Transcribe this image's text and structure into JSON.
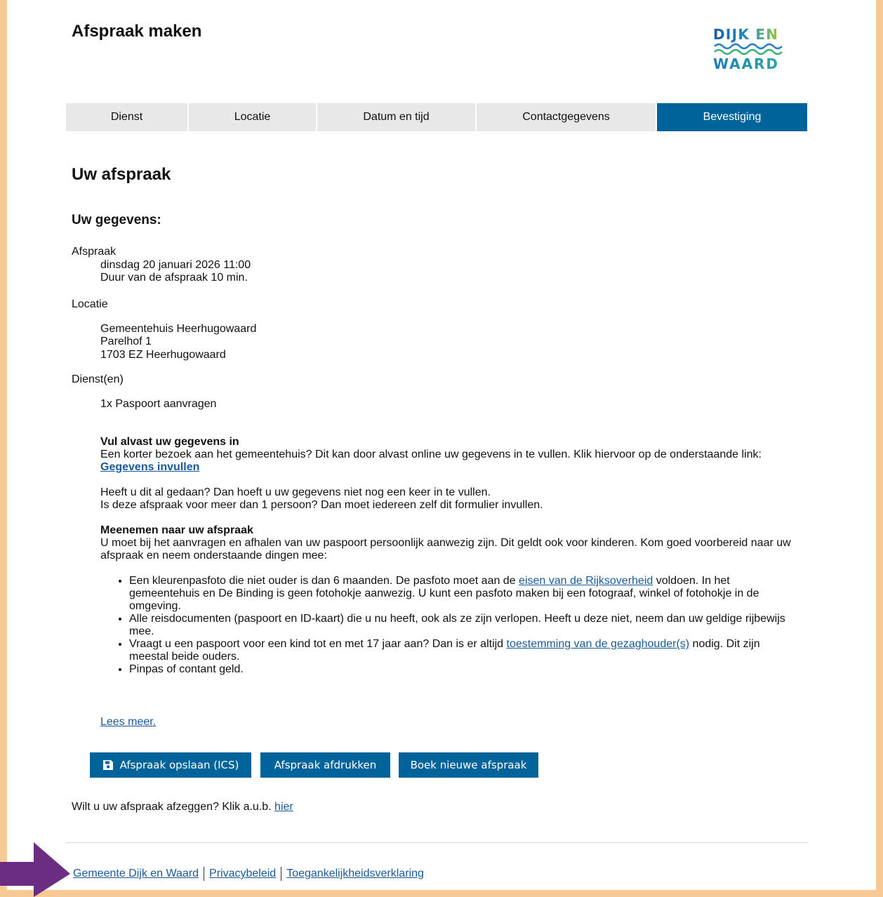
{
  "header": {
    "title": "Afspraak maken",
    "logo_text": "DIJK EN WAARD"
  },
  "steps": [
    {
      "label": "Dienst",
      "active": false
    },
    {
      "label": "Locatie",
      "active": false
    },
    {
      "label": "Datum en tijd",
      "active": false
    },
    {
      "label": "Contactgegevens",
      "active": false
    },
    {
      "label": "Bevestiging",
      "active": true
    }
  ],
  "main": {
    "heading": "Uw afspraak",
    "subheading": "Uw gegevens:",
    "afspraak": {
      "label": "Afspraak",
      "datetime": "dinsdag 20 januari 2026 11:00",
      "duration": "Duur van de afspraak 10 min."
    },
    "locatie": {
      "label": "Locatie",
      "name": "Gemeentehuis Heerhugowaard",
      "street": "Parelhof 1",
      "city": "1703 EZ Heerhugowaard"
    },
    "diensten": {
      "label": "Dienst(en)",
      "items": [
        "1x Paspoort aanvragen"
      ]
    },
    "info": {
      "prefill_title": "Vul alvast uw gegevens in",
      "prefill_text": "Een korter bezoek aan het gemeentehuis? Dit kan door alvast online uw gegevens in te vullen. Klik hiervoor op de onderstaande link:",
      "prefill_link": "Gegevens invullen",
      "done_line1": "Heeft u dit al gedaan? Dan hoeft u uw gegevens niet nog een keer in te vullen.",
      "done_line2": "Is deze afspraak voor meer dan 1 persoon? Dan moet iedereen zelf dit formulier invullen.",
      "bring_title": "Meenemen naar uw afspraak",
      "bring_text": "U moet bij het aanvragen en afhalen van uw paspoort persoonlijk aanwezig zijn. Dit geldt ook voor kinderen. Kom goed voorbereid naar uw afspraak en neem onderstaande dingen mee:"
    },
    "bullets": {
      "b1_pre": "Een kleurenpasfoto die niet ouder is dan 6 maanden. De pasfoto moet aan de ",
      "b1_link": "eisen van de Rijksoverheid",
      "b1_post": " voldoen. In het gemeentehuis en De Binding is geen fotohokje aanwezig. U kunt een pasfoto maken bij een fotograaf, winkel of fotohokje in de omgeving.",
      "b2": "Alle reisdocumenten (paspoort en ID-kaart) die u nu heeft, ook als ze zijn verlopen. Heeft u deze niet, neem dan uw geldige rijbewijs mee.",
      "b3_pre": "Vraagt u een paspoort voor een kind tot en met 17 jaar aan? Dan is er altijd ",
      "b3_link": "toestemming van de gezaghouder(s)",
      "b3_post": " nodig. Dit zijn meestal beide ouders.",
      "b4": "Pinpas of contant geld."
    },
    "read_more": "Lees meer."
  },
  "buttons": {
    "save_ics": "Afspraak opslaan (ICS)",
    "print": "Afspraak afdrukken",
    "new": "Boek nieuwe afspraak"
  },
  "cancel": {
    "text": "Wilt u uw afspraak afzeggen? Klik a.u.b. ",
    "link": "hier"
  },
  "footer": {
    "links": [
      "Gemeente Dijk en Waard",
      "Privacybeleid",
      "Toegankelijkheidsverklaring"
    ]
  },
  "colors": {
    "accent": "#00649a",
    "frame": "#f7c995",
    "arrow": "#6b2d82",
    "tab_bg": "#e8e8e8"
  }
}
